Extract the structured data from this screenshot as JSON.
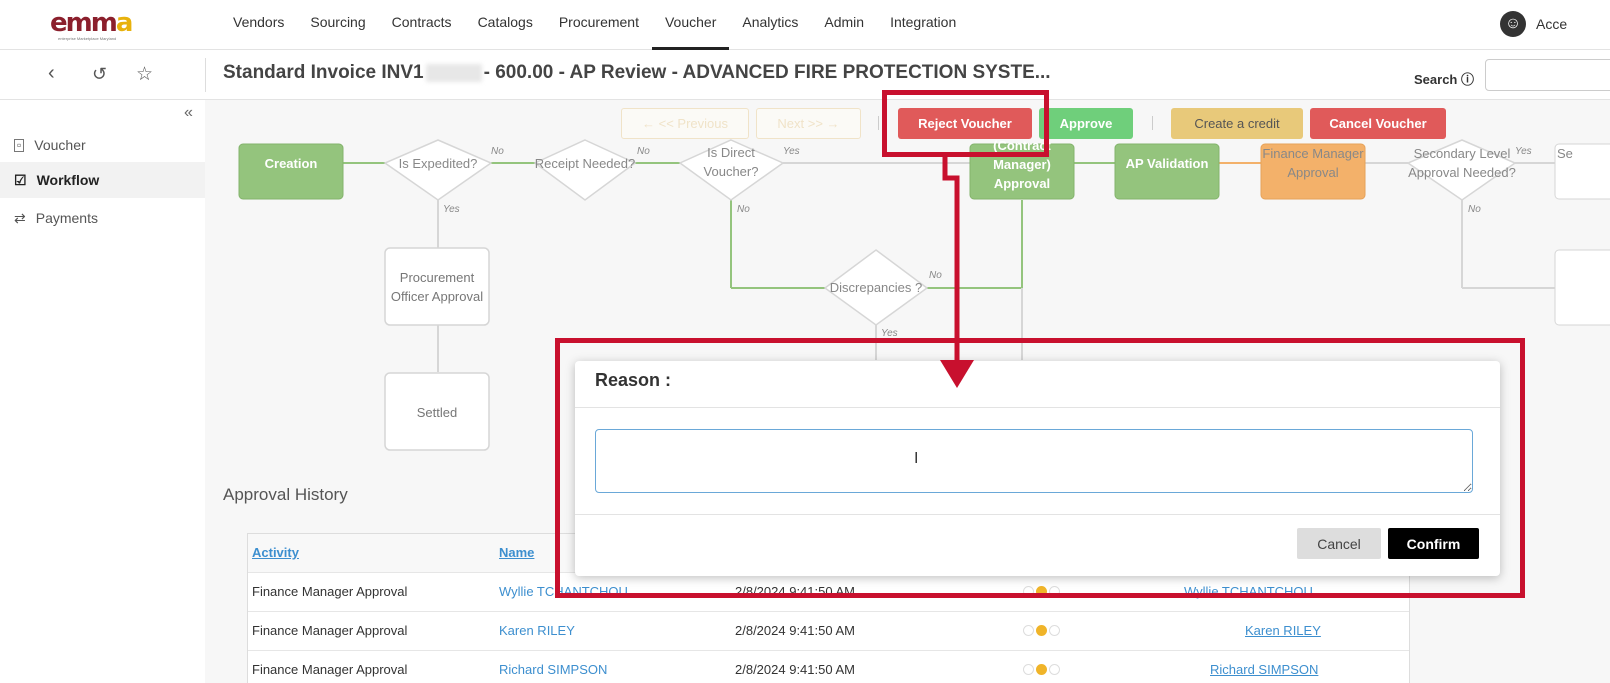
{
  "app": {
    "logo_text_main": "emm",
    "logo_text_accent": "a",
    "logo_tagline": "enterprise Marketplace Maryland",
    "accessibility_label": "Acce"
  },
  "nav": {
    "items": [
      "Vendors",
      "Sourcing",
      "Contracts",
      "Catalogs",
      "Procurement",
      "Voucher",
      "Analytics",
      "Admin",
      "Integration"
    ],
    "active": "Voucher"
  },
  "header": {
    "title_prefix": "Standard Invoice INV1",
    "title_suffix": "- 600.00 - AP Review - ADVANCED FIRE PROTECTION SYSTE...",
    "search_label": "Search",
    "search_info_icon": "info-icon"
  },
  "sidebar": {
    "collapse_icon": "«",
    "items": [
      {
        "label": "Voucher",
        "icon": "money-icon"
      },
      {
        "label": "Workflow",
        "icon": "checkbox-icon"
      },
      {
        "label": "Payments",
        "icon": "transfer-icon"
      }
    ],
    "active": "Workflow"
  },
  "actions": {
    "previous": "← << Previous",
    "next": "Next >> →",
    "reject": "Reject Voucher",
    "approve": "Approve",
    "create_credit": "Create a credit",
    "cancel_voucher": "Cancel Voucher"
  },
  "workflow": {
    "creation": "Creation",
    "is_expedited": "Is Expedited?",
    "receipt_needed": "Receipt Needed?",
    "is_direct": "Is Direct Voucher?",
    "contract_manager": "(Contract Manager) Approval",
    "ap_validation": "AP Validation",
    "finance_manager": "Finance Manager Approval",
    "secondary": "Secondary Level Approval Needed?",
    "partial_right": "Se",
    "procurement_officer": "Procurement Officer Approval",
    "discrepancies": "Discrepancies ?",
    "settled": "Settled",
    "no": "No",
    "yes": "Yes"
  },
  "history": {
    "title": "Approval History",
    "columns": [
      "Activity",
      "Name"
    ],
    "rows": [
      {
        "activity": "Finance Manager Approval",
        "name": "Wyllie TCHANTCHOU",
        "date": "2/8/2024 9:41:50 AM",
        "approver": "Wyllie TCHANTCHOU"
      },
      {
        "activity": "Finance Manager Approval",
        "name": "Karen RILEY",
        "date": "2/8/2024 9:41:50 AM",
        "approver": "Karen RILEY"
      },
      {
        "activity": "Finance Manager Approval",
        "name": "Richard SIMPSON",
        "date": "2/8/2024 9:41:50 AM",
        "approver": "Richard SIMPSON"
      }
    ]
  },
  "modal": {
    "title": "Reason :",
    "input_value": "",
    "cancel": "Cancel",
    "confirm": "Confirm"
  },
  "colors": {
    "annotation": "#c8102e",
    "green_node": "#94c47d",
    "orange_node": "#f3b16a",
    "red_button": "#e05a5a",
    "green_button": "#6fcf7b"
  }
}
